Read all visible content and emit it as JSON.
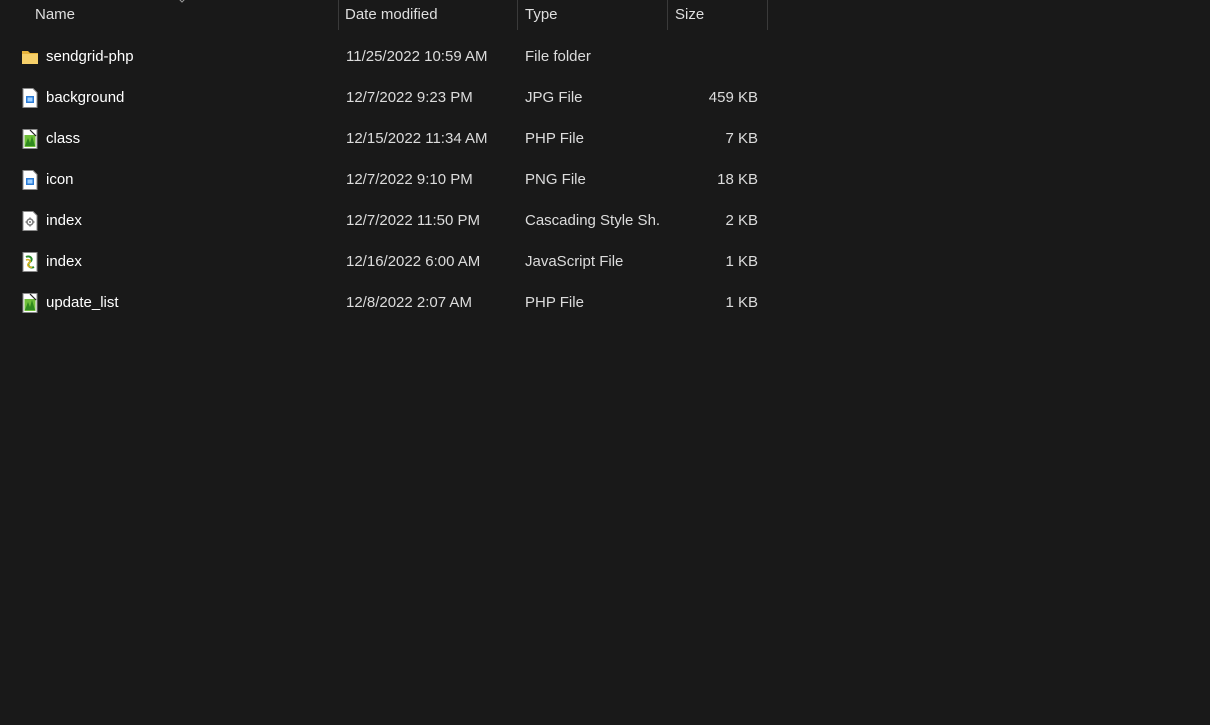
{
  "columns": {
    "name": "Name",
    "date_modified": "Date modified",
    "type": "Type",
    "size": "Size"
  },
  "files": [
    {
      "name": "sendgrid-php",
      "date": "11/25/2022 10:59 AM",
      "type": "File folder",
      "size": "",
      "icon": "folder-icon"
    },
    {
      "name": "background",
      "date": "12/7/2022 9:23 PM",
      "type": "JPG File",
      "size": "459 KB",
      "icon": "image-file-icon"
    },
    {
      "name": "class",
      "date": "12/15/2022 11:34 AM",
      "type": "PHP File",
      "size": "7 KB",
      "icon": "php-file-icon"
    },
    {
      "name": "icon",
      "date": "12/7/2022 9:10 PM",
      "type": "PNG File",
      "size": "18 KB",
      "icon": "image-file-icon"
    },
    {
      "name": "index",
      "date": "12/7/2022 11:50 PM",
      "type": "Cascading Style Sh...",
      "size": "2 KB",
      "icon": "css-file-icon"
    },
    {
      "name": "index",
      "date": "12/16/2022 6:00 AM",
      "type": "JavaScript File",
      "size": "1 KB",
      "icon": "js-file-icon"
    },
    {
      "name": "update_list",
      "date": "12/8/2022 2:07 AM",
      "type": "PHP File",
      "size": "1 KB",
      "icon": "php-file-icon"
    }
  ],
  "colors": {
    "background": "#191919",
    "header_text": "#dedede",
    "row_text": "#ffffff",
    "separator": "#3a3a3a",
    "folder": "#f4c64a"
  }
}
